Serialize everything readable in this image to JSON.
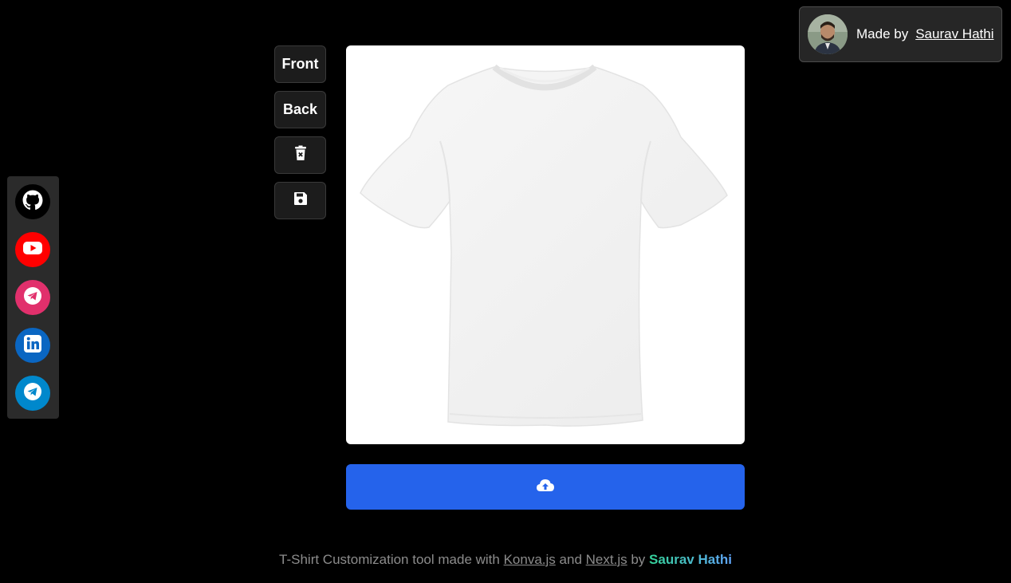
{
  "badge": {
    "made_by": "Made by",
    "author_link": "Saurav Hathi"
  },
  "social": {
    "items": [
      {
        "icon": "github-icon",
        "color": "#000000"
      },
      {
        "icon": "youtube-icon",
        "color": "#ff0000"
      },
      {
        "icon": "telegram-icon",
        "color": "#e1306c"
      },
      {
        "icon": "linkedin-icon",
        "color": "#0a66c2"
      },
      {
        "icon": "telegram-icon",
        "color": "#0088cc"
      }
    ]
  },
  "tools": {
    "front_label": "Front",
    "back_label": "Back",
    "delete_icon": "trash-icon",
    "save_icon": "save-icon"
  },
  "upload": {
    "icon": "cloud-upload-icon",
    "color": "#2563eb"
  },
  "footer": {
    "prefix": "T-Shirt Customization tool made with",
    "konva": "Konva.js",
    "and": "and",
    "next": "Next.js",
    "by": "by",
    "author": "Saurav Hathi"
  }
}
